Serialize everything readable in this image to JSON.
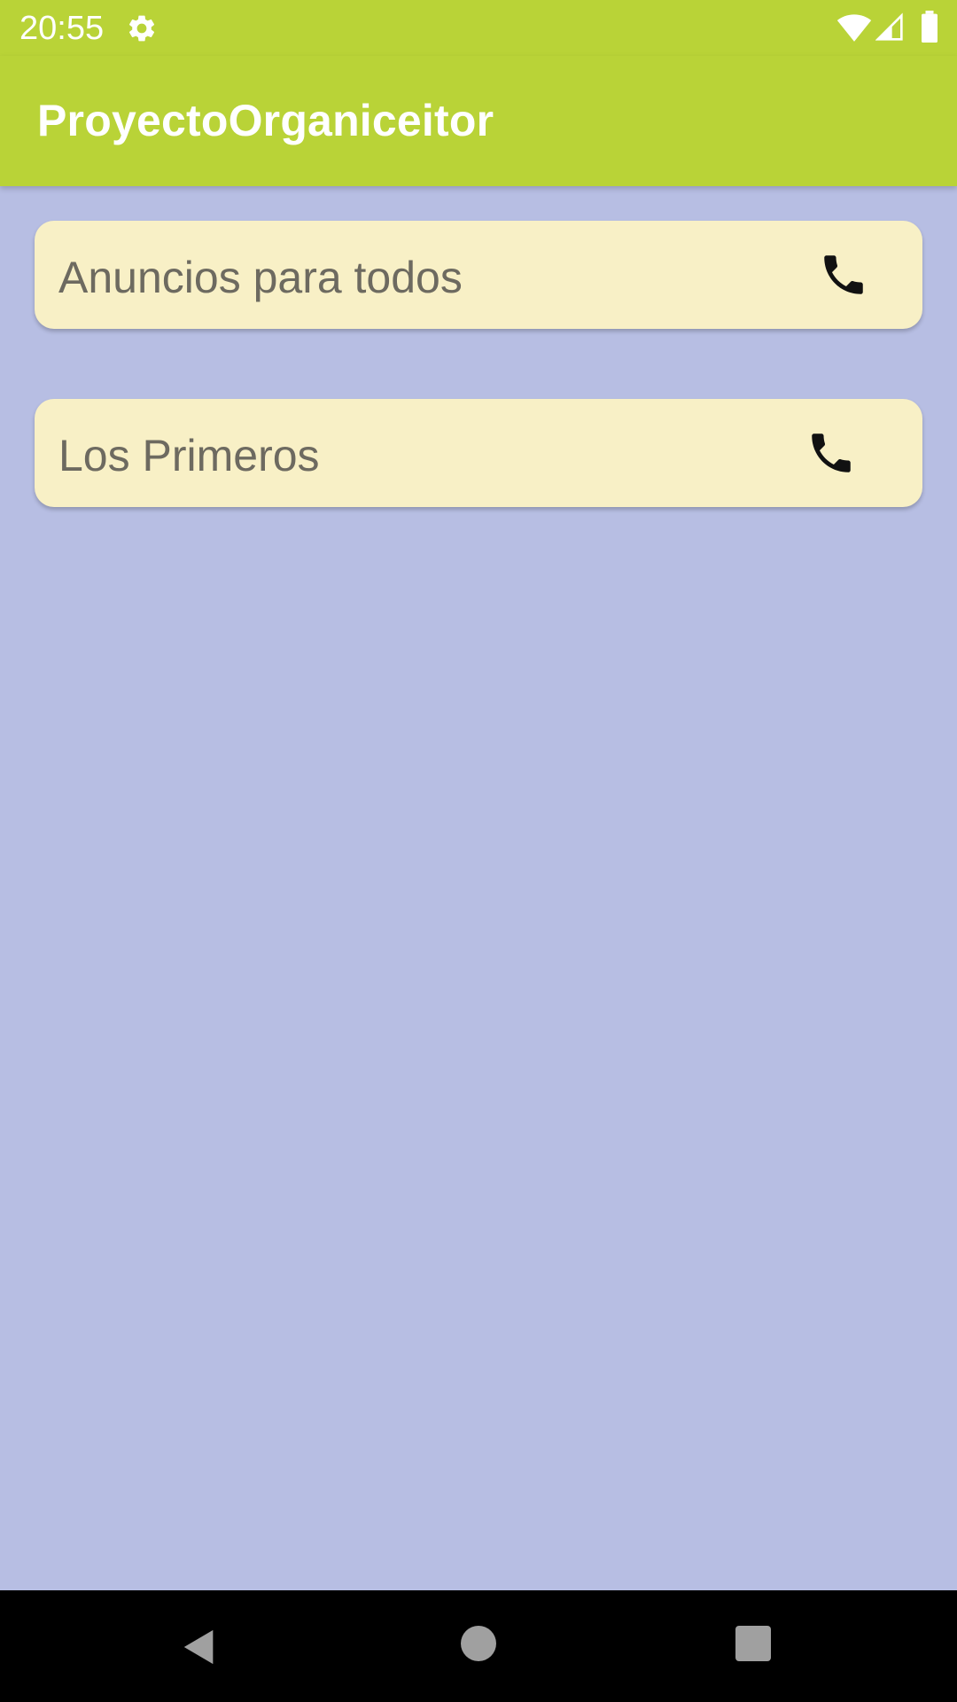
{
  "status_bar": {
    "time": "20:55",
    "icons": [
      "gear-icon",
      "wifi-icon",
      "signal-icon",
      "battery-icon"
    ]
  },
  "app_bar": {
    "title": "ProyectoOrganiceitor"
  },
  "list": {
    "items": [
      {
        "label": "Anuncios para todos",
        "icon": "phone-icon"
      },
      {
        "label": "Los Primeros",
        "icon": "phone-icon"
      }
    ]
  },
  "nav_bar": {
    "buttons": [
      "back-icon",
      "home-icon",
      "recents-icon"
    ]
  },
  "colors": {
    "app_bar": "#b9d337",
    "background": "#b7bee3",
    "card": "#f8f0c6",
    "card_text": "#6d6a60",
    "nav_bar": "#000000"
  }
}
